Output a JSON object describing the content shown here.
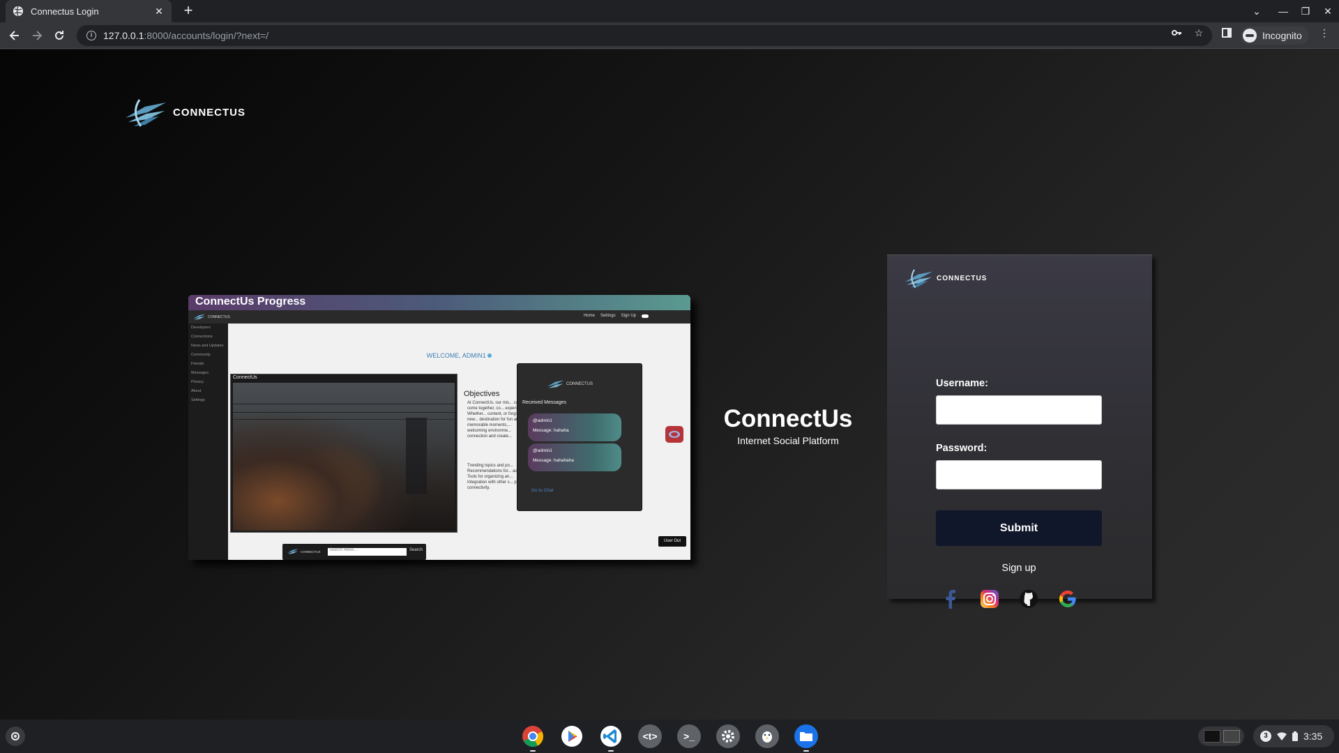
{
  "browser": {
    "tab_title": "Connectus Login",
    "url_host": "127.0.0.1",
    "url_rest": ":8000/accounts/login/?next=/",
    "profile_label": "Incognito"
  },
  "page": {
    "logo_text": "CONNECTUS",
    "title": "ConnectUs",
    "subtitle": "Internet Social Platform"
  },
  "preview": {
    "heading": "ConnectUs Progress",
    "logo_text": "CONNECTUS",
    "nav": [
      "Home",
      "Settings",
      "Sign Up"
    ],
    "sidebar": [
      "Developers",
      "Connections",
      "News and Updates",
      "Community",
      "Friends",
      "Messages",
      "Privacy",
      "About",
      "Settings"
    ],
    "welcome": "WELCOME, ADMIN1",
    "photo_caption": "ConnectUs",
    "objectives_title": "Objectives",
    "objectives_text": "At ConnectUs, our mis... can come together, co... experiences. Whether... content, or forging new... destination for fun and... memorable moments,... welcoming environme... connection and create...",
    "objectives_list": [
      "Trending topics and po...",
      "Recommendations for... activity.",
      "Tools for organizing an...",
      "Integration with other s... platform connectivity."
    ],
    "chat_logo_text": "CONNECTUS",
    "chat_title": "Received Messages",
    "messages": [
      {
        "user": "@admin1",
        "text": "Message: hahaha"
      },
      {
        "user": "@admin1",
        "text": "Message: hahahaha"
      }
    ],
    "go_to_chat": "Go to Chat",
    "search_placeholder": "Search News...",
    "search_button": "Search",
    "user_out": "User Out"
  },
  "login": {
    "logo_text": "CONNECTUS",
    "username_label": "Username:",
    "username_value": "",
    "password_label": "Password:",
    "password_value": "",
    "submit_label": "Submit",
    "signup_label": "Sign up",
    "socials": [
      "facebook-icon",
      "instagram-icon",
      "github-icon",
      "google-icon"
    ]
  },
  "shelf": {
    "apps": [
      "chrome",
      "play-store",
      "vscode",
      "text",
      "terminal",
      "settings",
      "linux",
      "files"
    ],
    "notification_count": "3",
    "time": "3:35"
  },
  "colors": {
    "submit_bg": "#11172a",
    "brand_accent": "#5b9bbf",
    "welcome_text": "#3d7fb3"
  }
}
